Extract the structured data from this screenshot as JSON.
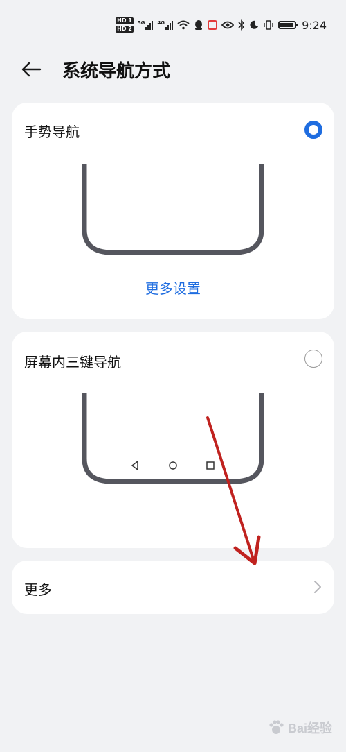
{
  "status_bar": {
    "time": "9:24",
    "hd1": "HD 1",
    "hd2": "HD 2",
    "sig1_label": "5G",
    "sig2_label": "4G",
    "battery_icon": "battery-icon",
    "wifi_icon": "wifi-icon",
    "bluetooth_icon": "bluetooth-icon",
    "moon_icon": "moon-icon",
    "eye_icon": "eye-icon",
    "vibrate_icon": "vibrate-icon"
  },
  "header": {
    "back_icon": "back-arrow-icon",
    "title": "系统导航方式"
  },
  "options": {
    "gesture": {
      "label": "手势导航",
      "selected": true,
      "more_settings": "更多设置"
    },
    "three_key": {
      "label": "屏幕内三键导航",
      "selected": false
    }
  },
  "more": {
    "label": "更多",
    "chevron_icon": "chevron-right-icon"
  },
  "colors": {
    "accent": "#1f6de0",
    "card_bg": "#ffffff",
    "page_bg": "#f1f2f4",
    "phone_outline": "#55565e",
    "annotation_arrow": "#c0221f"
  },
  "watermark": {
    "text": "Bai经验"
  }
}
